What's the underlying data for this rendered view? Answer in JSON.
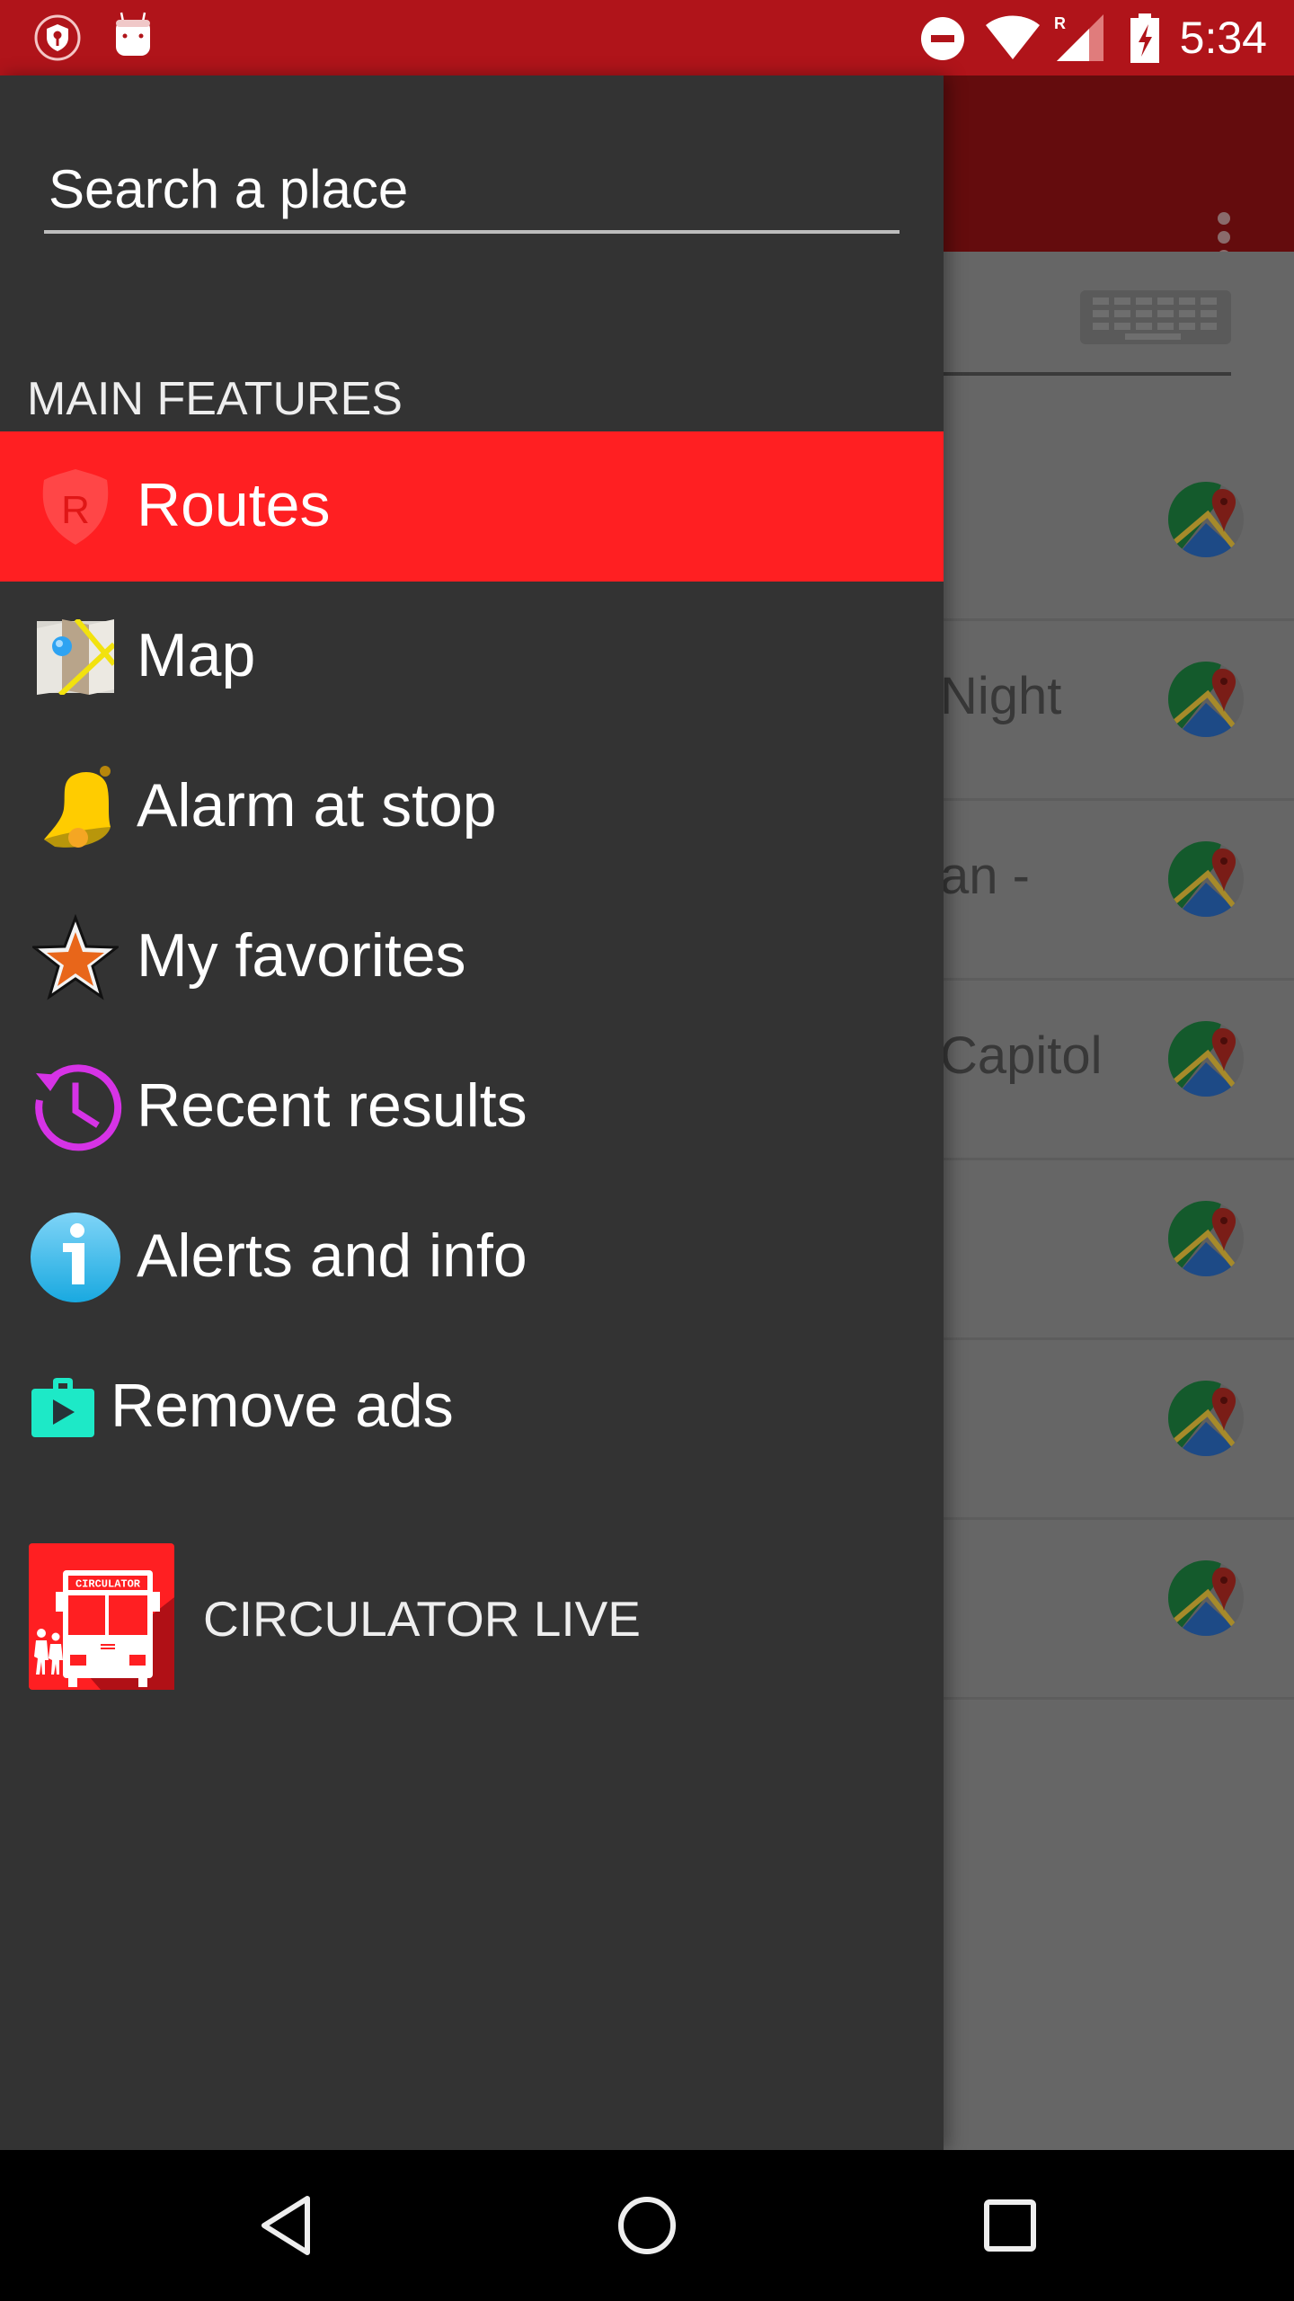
{
  "status_bar": {
    "time": "5:34",
    "left_icons": [
      "vpn-shield-key-icon",
      "android-robot-icon"
    ],
    "right_icons": [
      "do-not-disturb-icon",
      "wifi-icon",
      "cell-signal-roaming-icon",
      "battery-charging-icon"
    ],
    "roaming_indicator": "R",
    "background_color": "#b0141a"
  },
  "background_app": {
    "menu_icon": "overflow-menu-icon",
    "keyboard_icon": "keyboard-icon",
    "rows": [
      {
        "text": "",
        "icon": "google-maps-icon"
      },
      {
        "text": "Night",
        "icon": "google-maps-icon"
      },
      {
        "text": "an -",
        "icon": "google-maps-icon"
      },
      {
        "text": "Capitol",
        "icon": "google-maps-icon"
      },
      {
        "text": "",
        "icon": "google-maps-icon"
      },
      {
        "text": "",
        "icon": "google-maps-icon"
      },
      {
        "text": "",
        "icon": "google-maps-icon"
      }
    ]
  },
  "drawer": {
    "search": {
      "placeholder": "Search a place",
      "value": ""
    },
    "section_title": "MAIN FEATURES",
    "items": [
      {
        "label": "Routes",
        "icon": "route-shield-icon",
        "active": true
      },
      {
        "label": "Map",
        "icon": "map-icon",
        "active": false
      },
      {
        "label": "Alarm at stop",
        "icon": "bell-icon",
        "active": false
      },
      {
        "label": "My favorites",
        "icon": "star-icon",
        "active": false
      },
      {
        "label": "Recent results",
        "icon": "history-clock-icon",
        "active": false
      },
      {
        "label": "Alerts and info",
        "icon": "info-icon",
        "active": false
      },
      {
        "label": "Remove ads",
        "icon": "play-store-bag-icon",
        "active": false
      }
    ],
    "promo": {
      "label": "CIRCULATOR LIVE",
      "icon_text": "CIRCULATOR",
      "icon": "circulator-bus-app-icon"
    },
    "colors": {
      "background": "#333333",
      "active_item": "#ff1f22"
    }
  },
  "nav_bar": {
    "buttons": [
      "back-icon",
      "home-icon",
      "recents-icon"
    ]
  }
}
